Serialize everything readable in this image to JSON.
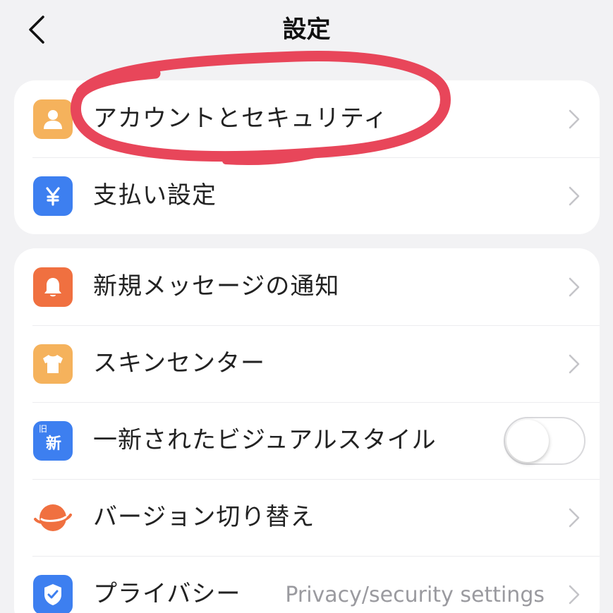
{
  "header": {
    "title": "設定",
    "back_icon": "chevron-left-icon"
  },
  "group1": {
    "items": [
      {
        "label": "アカウントとセキュリティ",
        "icon": "user-icon",
        "icon_color": "#f5b25c",
        "trailing": "chevron"
      },
      {
        "label": "支払い設定",
        "icon": "yen-icon",
        "icon_color": "#3d7ff0",
        "trailing": "chevron"
      }
    ]
  },
  "group2": {
    "items": [
      {
        "label": "新規メッセージの通知",
        "icon": "bell-icon",
        "icon_color": "#f07040",
        "trailing": "chevron"
      },
      {
        "label": "スキンセンター",
        "icon": "tshirt-icon",
        "icon_color": "#f5b25c",
        "trailing": "chevron"
      },
      {
        "label": "一新されたビジュアルスタイル",
        "icon": "old-new-icon",
        "icon_color": "#3d7ff0",
        "icon_text_top": "旧",
        "icon_text_main": "新",
        "trailing": "toggle",
        "toggle_on": false
      },
      {
        "label": "バージョン切り替え",
        "icon": "planet-icon",
        "icon_color": "#f07040",
        "trailing": "chevron"
      },
      {
        "label": "プライバシー",
        "sublabel": "Privacy/security settings",
        "icon": "shield-check-icon",
        "icon_color": "#3d7ff0",
        "trailing": "chevron"
      }
    ]
  },
  "annotation": {
    "shape": "hand-drawn-ellipse",
    "color": "#e8465a",
    "target": "アカウントとセキュリティ"
  },
  "colors": {
    "background": "#f2f2f4",
    "card": "#ffffff",
    "chevron": "#c4c4c8"
  }
}
